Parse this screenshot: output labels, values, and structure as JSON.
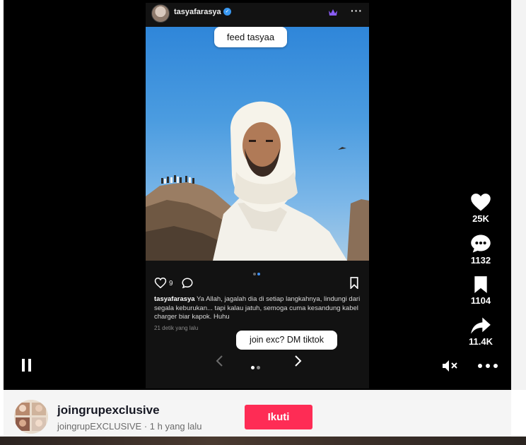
{
  "post": {
    "username": "tasyafarasya",
    "feed_label": "feed tasyaa",
    "like_count": "9",
    "caption_user": "tasyafarasya",
    "caption_text": " Ya Allah, jagalah dia di setiap langkahnya, lindungi dari segala keburukan... tapi kalau jatuh, semoga cuma kesandung kabel charger biar kapok. Huhu",
    "time_ago": "21 detik yang lalu",
    "dm_label": "join exc? DM tiktok"
  },
  "side_actions": {
    "likes": "25K",
    "comments": "1132",
    "saves": "1104",
    "shares": "11.4K"
  },
  "creator": {
    "name": "joingrupexclusive",
    "subtitle": "joingrupEXCLUSIVE · 1 h yang lalu",
    "follow_label": "Ikuti"
  },
  "colors": {
    "accent": "#fe2c55",
    "verified": "#3897f0",
    "crown": "#8a5cf6"
  },
  "icons": [
    "pause-icon",
    "mute-icon",
    "heart-icon",
    "comment-icon",
    "bookmark-icon",
    "share-icon",
    "more-icon",
    "chevron-left-icon",
    "chevron-right-icon",
    "verified-icon",
    "crown-icon"
  ]
}
